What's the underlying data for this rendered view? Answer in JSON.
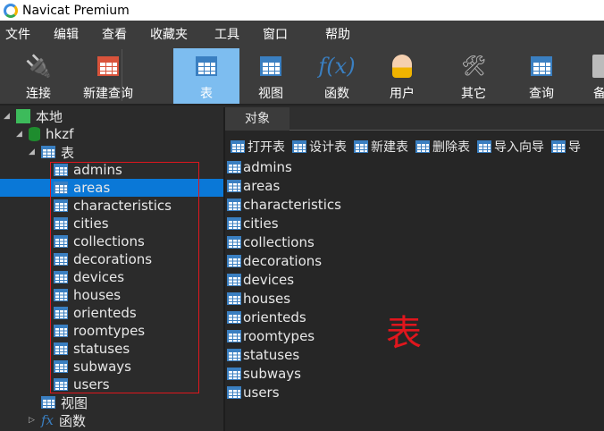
{
  "app": {
    "title": "Navicat Premium"
  },
  "menu": [
    "文件",
    "编辑",
    "查看",
    "收藏夹",
    "工具",
    "窗口",
    "帮助"
  ],
  "toolbar": {
    "connect": "连接",
    "new_query": "新建查询",
    "table": "表",
    "view": "视图",
    "function": "函数",
    "user": "用户",
    "other": "其它",
    "query": "查询",
    "backup": "备"
  },
  "tree": {
    "connection": "本地",
    "database": "hkzf",
    "tables_node": "表",
    "views_node": "视图",
    "functions_node": "函数",
    "selected": "areas",
    "tables": [
      "admins",
      "areas",
      "characteristics",
      "cities",
      "collections",
      "decorations",
      "devices",
      "houses",
      "orienteds",
      "roomtypes",
      "statuses",
      "subways",
      "users"
    ]
  },
  "main": {
    "tab": "对象",
    "actions": [
      "打开表",
      "设计表",
      "新建表",
      "删除表",
      "导入向导",
      "导"
    ],
    "objects": [
      "admins",
      "areas",
      "characteristics",
      "cities",
      "collections",
      "decorations",
      "devices",
      "houses",
      "orienteds",
      "roomtypes",
      "statuses",
      "subways",
      "users"
    ],
    "annotation": "表"
  },
  "colors": {
    "accent": "#0a78d7",
    "selected_tool": "#7dbdf0",
    "annotation": "#e0161d"
  }
}
